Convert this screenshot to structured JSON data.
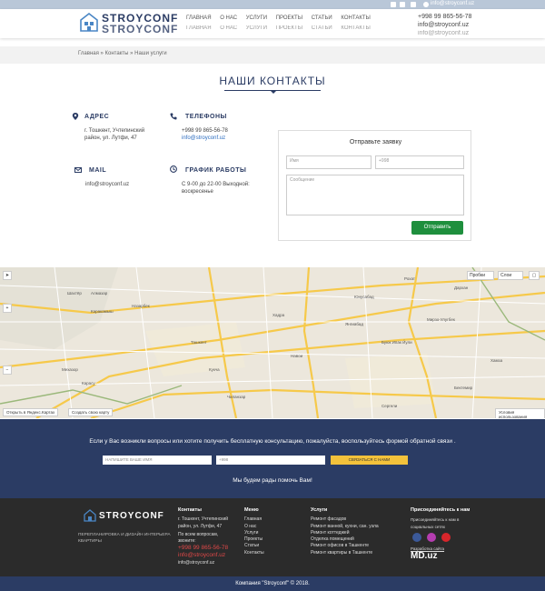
{
  "topbar": {
    "email": "info@stroyconf.uz"
  },
  "header": {
    "logo_text": "STROYCONF",
    "nav": [
      "ГЛАВНАЯ",
      "О НАС",
      "УСЛУГИ",
      "ПРОЕКТЫ",
      "СТАТЬИ",
      "КОНТАКТЫ"
    ],
    "phone": "+998 99 865-56-78",
    "email": "info@stroyconf.uz"
  },
  "breadcrumb": {
    "home": "Главная",
    "contacts": "» Контакты",
    "current": "» Наши услуги"
  },
  "page_title": "НАШИ КОНТАКТЫ",
  "contacts": {
    "address_title": "АДРЕС",
    "address_line1": "г. Тошкент, Учтепинский",
    "address_line2": "район, ул. Лутфи, 47",
    "phones_title": "ТЕЛЕФОНЫ",
    "phone": "+998 99 865-56-78",
    "email_link": "info@stroyconf.uz",
    "mail_title": "MAIL",
    "mail": "info@stroyconf.uz",
    "schedule_title": "ГРАФИК РАБОТЫ",
    "schedule_line1": "С 9-00 до 22-00 Выходной:",
    "schedule_line2": "воскресенье"
  },
  "form": {
    "title": "Отправьте заявку",
    "name_placeholder": "Имя",
    "phone_placeholder": "+998",
    "message_placeholder": "Сообщение",
    "submit": "Отправить"
  },
  "map": {
    "probki": "Пробки",
    "layers": "Слои",
    "open_link": "Открыть в Яндекс.Картах",
    "create_link": "Создать свою карту",
    "terms": "Условия использования",
    "labels": [
      "Шахтёр",
      "Алмазар",
      "Каракамыш",
      "Назарбек",
      "Ташкент",
      "Мехазор",
      "Карасу",
      "Кукча",
      "Хадра",
      "Навои",
      "Чиланзар",
      "Юнусабад",
      "Мирзо-Улугбек",
      "Бектемир",
      "Сергели",
      "Янгиабад",
      "Рохат",
      "Дархан",
      "Буюк Ипак Йули",
      "Хамза"
    ]
  },
  "cta": {
    "text": "Если у Вас возникли вопросы или хотите получить бесплатную консультацию, пожалуйста, воспользуйтесь формой обратной связи .",
    "name_placeholder": "НАПИШИТЕ ВАШЕ ИМЯ",
    "phone_placeholder": "+998",
    "button": "СВЯЗАТЬСЯ С НАМИ",
    "sub": "Мы будем рады помочь Вам!"
  },
  "footer": {
    "logo_text": "STROYCONF",
    "tagline1": "ПЕРЕПЛАНИРОВКА И ДИЗАЙН ИНТЕРЬЕРА",
    "tagline2": "КВАРТИРЫ",
    "contacts_head": "Контакты",
    "contacts_addr1": "г. Тошкент, Учтепинский",
    "contacts_addr2": "район, ул. Лутфи, 47",
    "contacts_q1": "По всем вопросам,",
    "contacts_q2": "звоните:",
    "phone": "+998 99 865-56-78",
    "email_big": "info@stroyconf.uz",
    "email_small": "info@stroyconf.uz",
    "menu_head": "Меню",
    "menu": [
      "Главная",
      "О нас",
      "Услуги",
      "Проекты",
      "Статьи",
      "Контакты"
    ],
    "services_head": "Услуги",
    "services": [
      "Ремонт фасадов",
      "Ремонт ванной, кухни, сан. узла",
      "Ремонт коттеджей",
      "Отделка помещений",
      "Ремонт офисов в Ташкенте",
      "Ремонт квартиры в Ташкенте"
    ],
    "join_head": "Присоединяйтесь к нам",
    "join_text1": "Присоединяйтесь к нам в",
    "join_text2": "социальных сетях",
    "dev_label": "Разработка сайта",
    "dev_name": "MD.uz"
  },
  "copyright": "Компания \"Stroyconf\" © 2018."
}
